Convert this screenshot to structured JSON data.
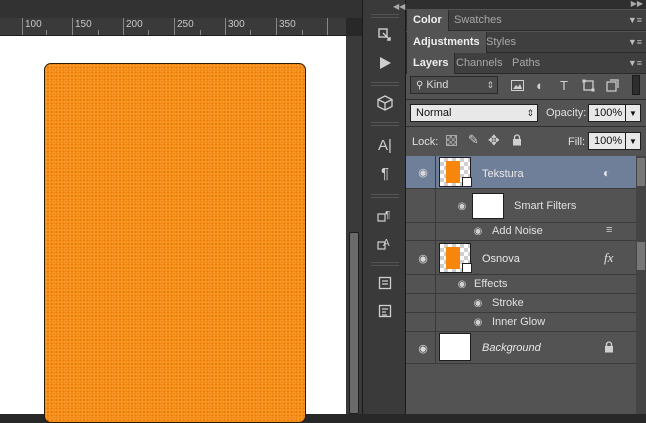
{
  "ruler": {
    "labels": [
      "100",
      "150",
      "200",
      "250",
      "300",
      "350"
    ]
  },
  "panel_groups": [
    {
      "tabs": [
        "Color",
        "Swatches"
      ],
      "active": 0
    },
    {
      "tabs": [
        "Adjustments",
        "Styles"
      ],
      "active": 0
    },
    {
      "tabs": [
        "Layers",
        "Channels",
        "Paths"
      ],
      "active": 0
    }
  ],
  "layers_panel": {
    "filter_kind": "Kind",
    "blend_mode": "Normal",
    "opacity_label": "Opacity:",
    "opacity_value": "100%",
    "lock_label": "Lock:",
    "fill_label": "Fill:",
    "fill_value": "100%"
  },
  "layers": [
    {
      "name": "Tekstura",
      "selected": true,
      "smart_filters_label": "Smart Filters",
      "filters": [
        "Add Noise"
      ]
    },
    {
      "name": "Osnova",
      "fx": "fx",
      "effects_label": "Effects",
      "effects": [
        "Stroke",
        "Inner Glow"
      ]
    },
    {
      "name": "Background",
      "locked": true
    }
  ],
  "colors": {
    "document_fill": "#f7870c",
    "selected_layer": "#6f7f99",
    "panel_bg": "#535353"
  },
  "icons": {
    "toolstrip": [
      "history-icon",
      "play-action-icon",
      "3d-icon",
      "character-icon",
      "paragraph-icon",
      "character-styles-icon",
      "paragraph-styles-icon",
      "notes-icon",
      "properties-icon"
    ],
    "filters": [
      "pixel-filter-icon",
      "adjustment-filter-icon",
      "type-filter-icon",
      "shape-filter-icon",
      "smart-object-filter-icon"
    ],
    "locks": [
      "lock-transparent-icon",
      "lock-pixels-icon",
      "lock-position-icon",
      "lock-all-icon"
    ]
  }
}
